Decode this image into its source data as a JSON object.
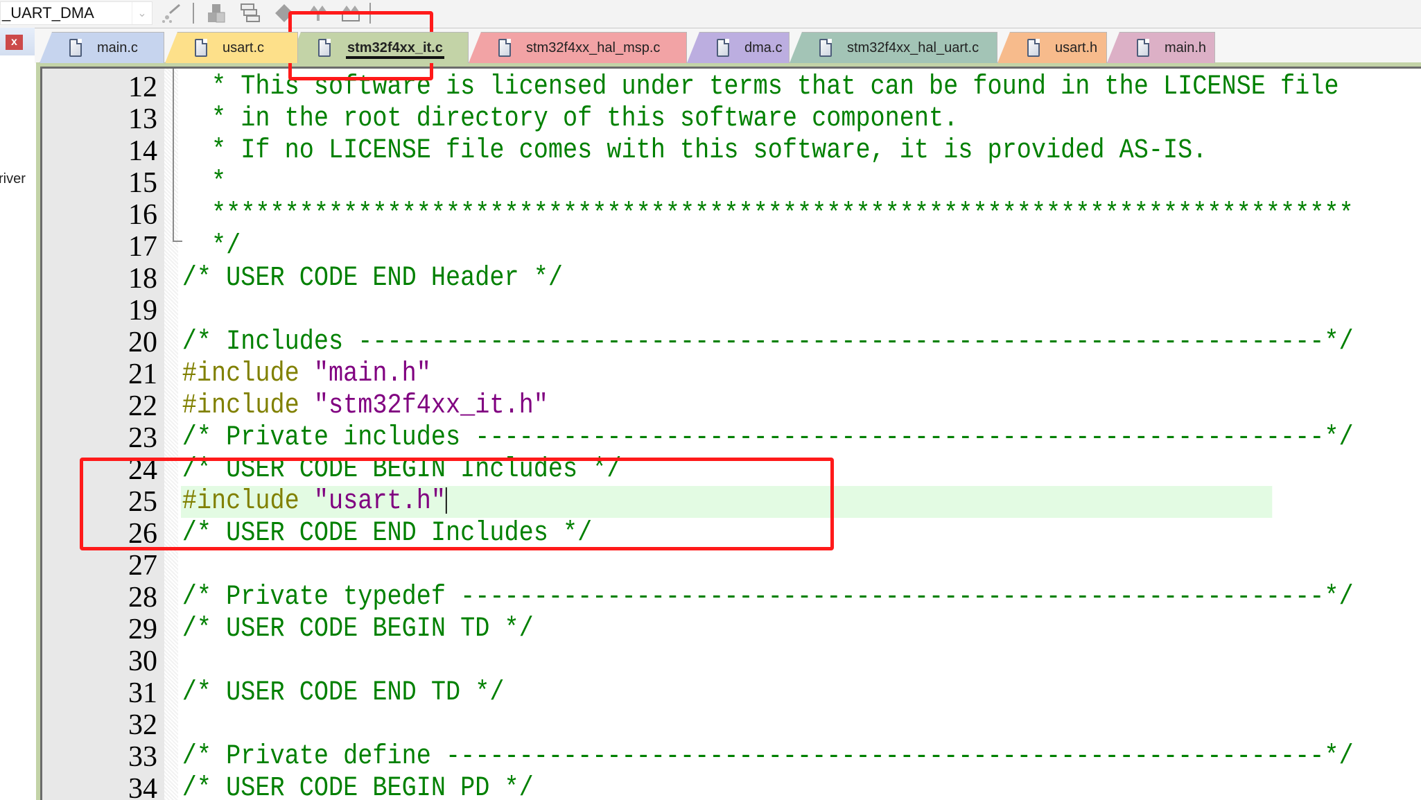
{
  "toolbar": {
    "target_value": "_UART_DMA",
    "icons": [
      "dropdown-chevron-icon",
      "wizard-icon",
      "manage-components-icon",
      "window-layout-icon",
      "pack-installer-icon",
      "download-icon",
      "erase-icon"
    ]
  },
  "left_panel": {
    "close_label": "x",
    "tree_fragment": "river"
  },
  "tabs": [
    {
      "label": "main.c",
      "color": "#c6d4ee",
      "active": false
    },
    {
      "label": "usart.c",
      "color": "#fde08a",
      "active": false
    },
    {
      "label": "stm32f4xx_it.c",
      "color": "#c3d3a7",
      "active": true
    },
    {
      "label": "stm32f4xx_hal_msp.c",
      "color": "#f2a3a5",
      "active": false
    },
    {
      "label": "dma.c",
      "color": "#bcaee0",
      "active": false
    },
    {
      "label": "stm32f4xx_hal_uart.c",
      "color": "#a3c4b6",
      "active": false
    },
    {
      "label": "usart.h",
      "color": "#f7bb8c",
      "active": false
    },
    {
      "label": "main.h",
      "color": "#dcb0c6",
      "active": false
    }
  ],
  "editor": {
    "current_line": 25,
    "lines": [
      {
        "n": "12",
        "tokens": [
          {
            "t": "comment",
            "v": "  * This software is licensed under terms that can be found in the LICENSE file"
          }
        ]
      },
      {
        "n": "13",
        "tokens": [
          {
            "t": "comment",
            "v": "  * in the root directory of this software component."
          }
        ]
      },
      {
        "n": "14",
        "tokens": [
          {
            "t": "comment",
            "v": "  * If no LICENSE file comes with this software, it is provided AS-IS."
          }
        ]
      },
      {
        "n": "15",
        "tokens": [
          {
            "t": "comment",
            "v": "  *"
          }
        ]
      },
      {
        "n": "16",
        "tokens": [
          {
            "t": "comment",
            "v": "  ******************************************************************************"
          }
        ]
      },
      {
        "n": "17",
        "tokens": [
          {
            "t": "comment",
            "v": "  */"
          }
        ]
      },
      {
        "n": "18",
        "tokens": [
          {
            "t": "comment",
            "v": "/* USER CODE END Header */"
          }
        ]
      },
      {
        "n": "19",
        "tokens": []
      },
      {
        "n": "20",
        "tokens": [
          {
            "t": "comment",
            "v": "/* Includes ------------------------------------------------------------------*/"
          }
        ]
      },
      {
        "n": "21",
        "tokens": [
          {
            "t": "pre",
            "v": "#include "
          },
          {
            "t": "str",
            "v": "\"main.h\""
          }
        ]
      },
      {
        "n": "22",
        "tokens": [
          {
            "t": "pre",
            "v": "#include "
          },
          {
            "t": "str",
            "v": "\"stm32f4xx_it.h\""
          }
        ]
      },
      {
        "n": "23",
        "tokens": [
          {
            "t": "comment",
            "v": "/* Private includes ----------------------------------------------------------*/"
          }
        ]
      },
      {
        "n": "24",
        "tokens": [
          {
            "t": "comment",
            "v": "/* USER CODE BEGIN Includes */"
          }
        ]
      },
      {
        "n": "25",
        "tokens": [
          {
            "t": "pre",
            "v": "#include "
          },
          {
            "t": "str",
            "v": "\"usart.h\""
          }
        ]
      },
      {
        "n": "26",
        "tokens": [
          {
            "t": "comment",
            "v": "/* USER CODE END Includes */"
          }
        ]
      },
      {
        "n": "27",
        "tokens": []
      },
      {
        "n": "28",
        "tokens": [
          {
            "t": "comment",
            "v": "/* Private typedef -----------------------------------------------------------*/"
          }
        ]
      },
      {
        "n": "29",
        "tokens": [
          {
            "t": "comment",
            "v": "/* USER CODE BEGIN TD */"
          }
        ]
      },
      {
        "n": "30",
        "tokens": []
      },
      {
        "n": "31",
        "tokens": [
          {
            "t": "comment",
            "v": "/* USER CODE END TD */"
          }
        ]
      },
      {
        "n": "32",
        "tokens": []
      },
      {
        "n": "33",
        "tokens": [
          {
            "t": "comment",
            "v": "/* Private define ------------------------------------------------------------*/"
          }
        ]
      },
      {
        "n": "34",
        "tokens": [
          {
            "t": "comment",
            "v": "/* USER CODE BEGIN PD */"
          }
        ]
      }
    ]
  },
  "annotations": [
    {
      "name": "active-tab-highlight",
      "target": "stm32f4xx_it.c",
      "color": "#ff1a1a"
    },
    {
      "name": "includes-block-highlight",
      "target_lines": [
        "24",
        "25",
        "26"
      ],
      "color": "#ff1a1a"
    }
  ]
}
